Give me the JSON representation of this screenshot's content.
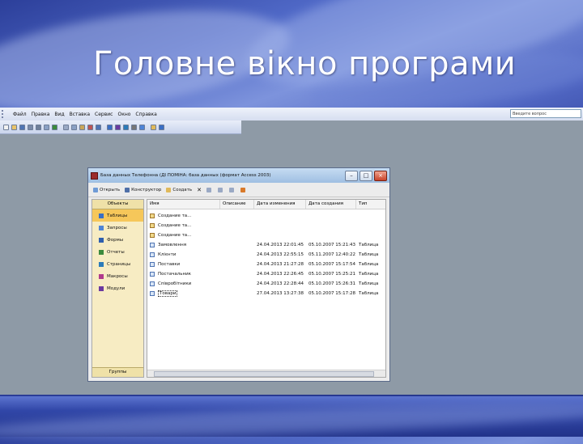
{
  "slide": {
    "title": "Головне вікно програми"
  },
  "app": {
    "menu": [
      "Файл",
      "Правка",
      "Вид",
      "Вставка",
      "Сервис",
      "Окно",
      "Справка"
    ],
    "help_placeholder": "Введите вопрос",
    "toolbar_icons": [
      "new-icon",
      "open-icon",
      "save-icon",
      "search-icon",
      "print-icon",
      "preview-icon",
      "spell-icon",
      "cut-icon",
      "copy-icon",
      "paste-icon",
      "format-icon",
      "undo-icon",
      "link-icon",
      "analyze-icon",
      "code-icon",
      "properties-icon",
      "relationships-icon",
      "new-object-icon",
      "help-icon"
    ]
  },
  "db_window": {
    "title": "База данных Телефонна (ДІ ПОМІНА: база данных (формат Access 2003)",
    "toolbar": {
      "open": "Открыть",
      "design": "Конструктор",
      "create": "Создать"
    },
    "objects_header": "Объекты",
    "objects": [
      {
        "label": "Таблицы",
        "color": "#3a6fc4"
      },
      {
        "label": "Запросы",
        "color": "#4e84d6"
      },
      {
        "label": "Формы",
        "color": "#2f5fae"
      },
      {
        "label": "Отчеты",
        "color": "#3c8a3c"
      },
      {
        "label": "Страницы",
        "color": "#2b7bb9"
      },
      {
        "label": "Макросы",
        "color": "#b03a8c"
      },
      {
        "label": "Модули",
        "color": "#6b3aa0"
      }
    ],
    "groups_label": "Группы",
    "columns": [
      "Имя",
      "Описание",
      "Дата изменения",
      "Дата создания",
      "Тип"
    ],
    "rows": [
      {
        "name": "Создание та...",
        "modified": "",
        "created": "",
        "type": "",
        "wizard": true
      },
      {
        "name": "Создание та...",
        "modified": "",
        "created": "",
        "type": "",
        "wizard": true
      },
      {
        "name": "Создание та...",
        "modified": "",
        "created": "",
        "type": "",
        "wizard": true
      },
      {
        "name": "Замовлення",
        "modified": "24.04.2013 22:01:45",
        "created": "05.10.2007 15:21:43",
        "type": "Таблица"
      },
      {
        "name": "Клієнти",
        "modified": "24.04.2013 22:55:15",
        "created": "05.11.2007 12:40:22",
        "type": "Таблица"
      },
      {
        "name": "Поставки",
        "modified": "24.04.2013 21:27:28",
        "created": "05.10.2007 15:17:54",
        "type": "Таблица"
      },
      {
        "name": "Постачальник",
        "modified": "24.04.2013 22:26:45",
        "created": "05.10.2007 15:25:21",
        "type": "Таблица"
      },
      {
        "name": "Співробітники",
        "modified": "24.04.2013 22:28:44",
        "created": "05.10.2007 15:26:31",
        "type": "Таблица"
      },
      {
        "name": "Товари",
        "modified": "27.04.2013 13:27:38",
        "created": "05.10.2007 15:17:28",
        "type": "Таблица",
        "selected": true
      }
    ]
  }
}
